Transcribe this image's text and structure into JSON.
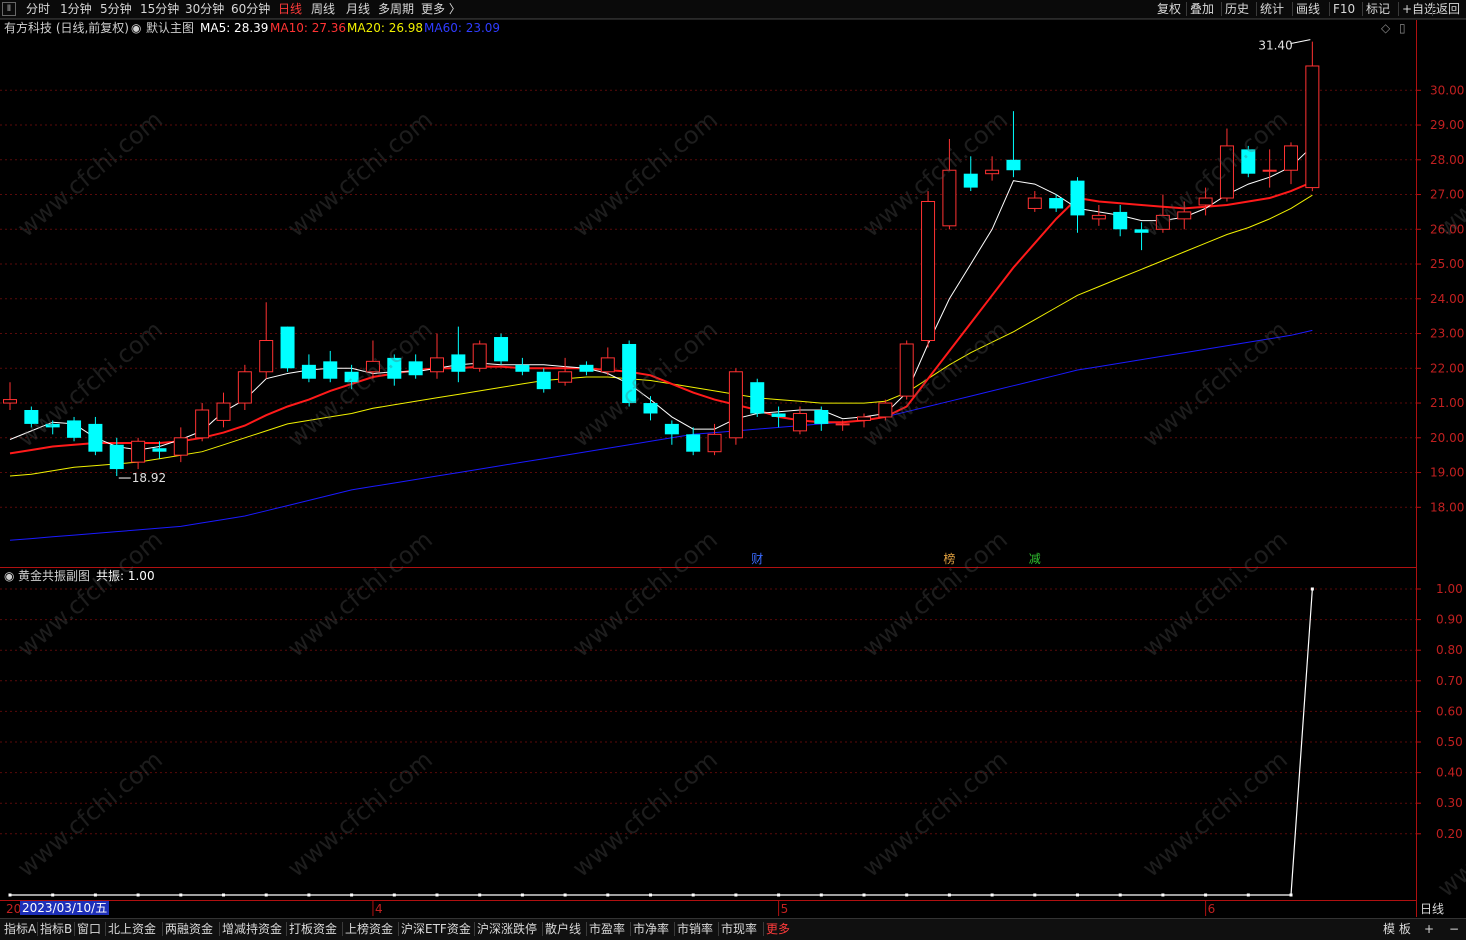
{
  "toolbar": {
    "corner": "Ⅱ",
    "periods": [
      {
        "label": "分时",
        "active": false
      },
      {
        "label": "1分钟",
        "active": false
      },
      {
        "label": "5分钟",
        "active": false
      },
      {
        "label": "15分钟",
        "active": false
      },
      {
        "label": "30分钟",
        "active": false
      },
      {
        "label": "60分钟",
        "active": false
      },
      {
        "label": "日线",
        "active": true
      },
      {
        "label": "周线",
        "active": false
      },
      {
        "label": "月线",
        "active": false
      },
      {
        "label": "多周期",
        "active": false
      },
      {
        "label": "更多 〉",
        "active": false
      }
    ],
    "right": [
      "复权",
      "叠加",
      "历史",
      "统计",
      "画线",
      "F10",
      "标记",
      "+自选",
      "返回"
    ]
  },
  "main_info": {
    "stock": "有方科技 (日线,前复权)",
    "template": "默认主图",
    "ma5": "MA5: 28.39",
    "ma10": "MA10: 27.36",
    "ma20": "MA20: 26.98",
    "ma60": "MA60: 23.09"
  },
  "sub_info": {
    "name": "黄金共振副图",
    "value": "共振: 1.00"
  },
  "colors": {
    "up": "#ff3232",
    "down": "#00ffff",
    "ma5": "#ffffff",
    "ma10": "#ff1a1a",
    "ma20": "#f0f000",
    "ma60": "#1a1aff",
    "axis": "#b01010"
  },
  "markers": {
    "high_label": "31.40",
    "low_label": "18.92",
    "events": [
      "财",
      "榜",
      "减"
    ]
  },
  "x_axis": {
    "date_box": "2023/03/10/五",
    "month_labels": [
      "4",
      "5",
      "6"
    ],
    "period": "日线",
    "left_cut": "20"
  },
  "chart_data": [
    {
      "type": "candlestick",
      "title": "",
      "ylim": [
        17.0,
        32.0
      ],
      "yticks": [
        "30.00",
        "29.00",
        "28.00",
        "27.00",
        "26.00",
        "25.00",
        "24.00",
        "23.00",
        "22.00",
        "21.00",
        "20.00",
        "19.00",
        "18.00"
      ],
      "candles": [
        [
          21.0,
          21.1,
          21.6,
          20.8
        ],
        [
          20.8,
          20.4,
          20.9,
          20.3
        ],
        [
          20.4,
          20.3,
          20.5,
          20.1
        ],
        [
          20.5,
          20.0,
          20.6,
          19.9
        ],
        [
          20.4,
          19.6,
          20.6,
          19.5
        ],
        [
          19.8,
          19.1,
          20.0,
          18.9
        ],
        [
          19.3,
          19.9,
          20.0,
          19.1
        ],
        [
          19.7,
          19.6,
          19.9,
          19.4
        ],
        [
          19.5,
          20.0,
          20.3,
          19.3
        ],
        [
          20.0,
          20.8,
          21.0,
          19.9
        ],
        [
          20.5,
          21.0,
          21.3,
          20.3
        ],
        [
          21.0,
          21.9,
          22.1,
          20.8
        ],
        [
          21.9,
          22.8,
          23.9,
          21.7
        ],
        [
          23.2,
          22.0,
          23.2,
          21.9
        ],
        [
          22.1,
          21.7,
          22.4,
          21.6
        ],
        [
          22.2,
          21.7,
          22.5,
          21.6
        ],
        [
          21.9,
          21.6,
          22.1,
          21.4
        ],
        [
          21.9,
          22.2,
          22.8,
          21.7
        ],
        [
          22.3,
          21.7,
          22.4,
          21.5
        ],
        [
          22.2,
          21.8,
          22.4,
          21.7
        ],
        [
          21.9,
          22.3,
          23.0,
          21.7
        ],
        [
          22.4,
          21.9,
          23.2,
          21.6
        ],
        [
          22.0,
          22.7,
          22.8,
          21.9
        ],
        [
          22.9,
          22.2,
          23.0,
          22.1
        ],
        [
          22.1,
          21.9,
          22.3,
          21.8
        ],
        [
          21.9,
          21.4,
          22.0,
          21.3
        ],
        [
          21.6,
          21.9,
          22.3,
          21.5
        ],
        [
          22.1,
          21.9,
          22.2,
          21.8
        ],
        [
          21.9,
          22.3,
          22.6,
          21.8
        ],
        [
          22.7,
          21.0,
          22.8,
          20.9
        ],
        [
          21.0,
          20.7,
          21.2,
          20.5
        ],
        [
          20.4,
          20.1,
          20.5,
          19.8
        ],
        [
          20.1,
          19.6,
          20.3,
          19.5
        ],
        [
          19.6,
          20.1,
          20.4,
          19.5
        ],
        [
          20.0,
          21.9,
          22.0,
          19.8
        ],
        [
          21.6,
          20.7,
          21.7,
          20.6
        ],
        [
          20.7,
          20.6,
          20.9,
          20.3
        ],
        [
          20.2,
          20.7,
          20.9,
          20.1
        ],
        [
          20.8,
          20.4,
          20.9,
          20.2
        ],
        [
          20.4,
          20.4,
          20.5,
          20.2
        ],
        [
          20.5,
          20.6,
          20.7,
          20.3
        ],
        [
          20.6,
          21.0,
          21.1,
          20.5
        ],
        [
          21.2,
          22.7,
          22.8,
          21.1
        ],
        [
          22.8,
          26.8,
          27.1,
          22.6
        ],
        [
          26.1,
          27.7,
          28.6,
          26.0
        ],
        [
          27.6,
          27.2,
          28.1,
          27.1
        ],
        [
          27.6,
          27.7,
          28.1,
          27.4
        ],
        [
          28.0,
          27.7,
          29.4,
          27.5
        ],
        [
          26.6,
          26.9,
          27.1,
          26.5
        ],
        [
          26.9,
          26.6,
          27.0,
          26.5
        ],
        [
          27.4,
          26.4,
          27.5,
          25.9
        ],
        [
          26.3,
          26.4,
          26.7,
          26.1
        ],
        [
          26.5,
          26.0,
          26.7,
          25.8
        ],
        [
          26.0,
          25.9,
          26.2,
          25.4
        ],
        [
          26.0,
          26.4,
          27.0,
          25.9
        ],
        [
          26.3,
          26.5,
          26.8,
          26.0
        ],
        [
          26.7,
          26.9,
          27.2,
          26.4
        ],
        [
          26.9,
          28.4,
          28.9,
          26.8
        ],
        [
          28.3,
          27.6,
          28.4,
          27.5
        ],
        [
          27.7,
          27.7,
          28.3,
          27.2
        ],
        [
          27.7,
          28.4,
          28.5,
          27.3
        ],
        [
          27.2,
          30.7,
          31.4,
          27.1
        ]
      ],
      "ma5": [
        19.95,
        20.2,
        20.45,
        20.4,
        20.0,
        19.75,
        19.65,
        19.75,
        19.95,
        20.2,
        20.75,
        21.1,
        21.7,
        21.85,
        21.95,
        22.0,
        22.0,
        21.85,
        21.9,
        21.9,
        22.0,
        22.1,
        22.15,
        22.1,
        22.1,
        22.1,
        22.05,
        22.0,
        21.85,
        21.55,
        21.1,
        20.6,
        20.25,
        20.25,
        20.55,
        20.7,
        20.75,
        20.8,
        20.8,
        20.55,
        20.6,
        20.7,
        21.3,
        22.7,
        24.0,
        25.0,
        26.0,
        27.4,
        27.3,
        27.0,
        26.6,
        26.5,
        26.4,
        26.25,
        26.25,
        26.35,
        26.6,
        27.0,
        27.3,
        27.5,
        27.8,
        28.39
      ],
      "ma10": [
        19.55,
        19.65,
        19.75,
        19.8,
        19.85,
        19.85,
        19.85,
        19.85,
        19.9,
        20.0,
        20.15,
        20.35,
        20.65,
        20.9,
        21.1,
        21.35,
        21.55,
        21.75,
        21.85,
        21.95,
        22.0,
        22.0,
        22.05,
        22.05,
        22.0,
        22.0,
        22.0,
        22.0,
        21.95,
        21.9,
        21.8,
        21.55,
        21.3,
        21.1,
        20.95,
        20.8,
        20.6,
        20.5,
        20.45,
        20.45,
        20.5,
        20.6,
        20.9,
        21.7,
        22.5,
        23.3,
        24.1,
        24.9,
        25.6,
        26.3,
        26.9,
        26.8,
        26.75,
        26.7,
        26.65,
        26.6,
        26.65,
        26.7,
        26.8,
        26.9,
        27.1,
        27.36
      ],
      "ma20": [
        18.9,
        18.95,
        19.05,
        19.15,
        19.2,
        19.25,
        19.3,
        19.4,
        19.5,
        19.6,
        19.8,
        20.0,
        20.2,
        20.4,
        20.5,
        20.6,
        20.7,
        20.85,
        20.95,
        21.05,
        21.15,
        21.25,
        21.35,
        21.45,
        21.55,
        21.65,
        21.7,
        21.75,
        21.75,
        21.7,
        21.65,
        21.55,
        21.45,
        21.35,
        21.25,
        21.15,
        21.1,
        21.05,
        21.0,
        21.0,
        21.0,
        21.05,
        21.3,
        21.7,
        22.1,
        22.45,
        22.75,
        23.05,
        23.4,
        23.75,
        24.1,
        24.35,
        24.6,
        24.85,
        25.1,
        25.35,
        25.6,
        25.85,
        26.05,
        26.3,
        26.6,
        26.98
      ],
      "ma60": [
        17.05,
        17.1,
        17.15,
        17.2,
        17.25,
        17.3,
        17.35,
        17.4,
        17.45,
        17.55,
        17.65,
        17.75,
        17.9,
        18.05,
        18.2,
        18.35,
        18.5,
        18.6,
        18.7,
        18.8,
        18.9,
        19.0,
        19.1,
        19.2,
        19.3,
        19.4,
        19.5,
        19.6,
        19.7,
        19.8,
        19.9,
        20.0,
        20.1,
        20.15,
        20.2,
        20.25,
        20.3,
        20.35,
        20.4,
        20.45,
        20.5,
        20.6,
        20.75,
        20.9,
        21.05,
        21.2,
        21.35,
        21.5,
        21.65,
        21.8,
        21.95,
        22.05,
        22.15,
        22.25,
        22.35,
        22.45,
        22.55,
        22.65,
        22.75,
        22.85,
        22.95,
        23.09
      ]
    },
    {
      "type": "line",
      "title": "",
      "ylim": [
        0,
        1.05
      ],
      "yticks": [
        "1.00",
        "0.90",
        "0.80",
        "0.70",
        "0.60",
        "0.50",
        "0.40",
        "0.30",
        "0.20"
      ],
      "series": [
        {
          "values": [
            0,
            0,
            0,
            0,
            0,
            0,
            0,
            0,
            0,
            0,
            0,
            0,
            0,
            0,
            0,
            0,
            0,
            0,
            0,
            0,
            0,
            0,
            0,
            0,
            0,
            0,
            0,
            0,
            0,
            0,
            0,
            0,
            0,
            0,
            0,
            0,
            0,
            0,
            0,
            0,
            0,
            0,
            0,
            0,
            0,
            0,
            0,
            0,
            0,
            0,
            0,
            0,
            0,
            0,
            0,
            0,
            0,
            0,
            0,
            0,
            0,
            1.0
          ]
        }
      ]
    }
  ]
}
